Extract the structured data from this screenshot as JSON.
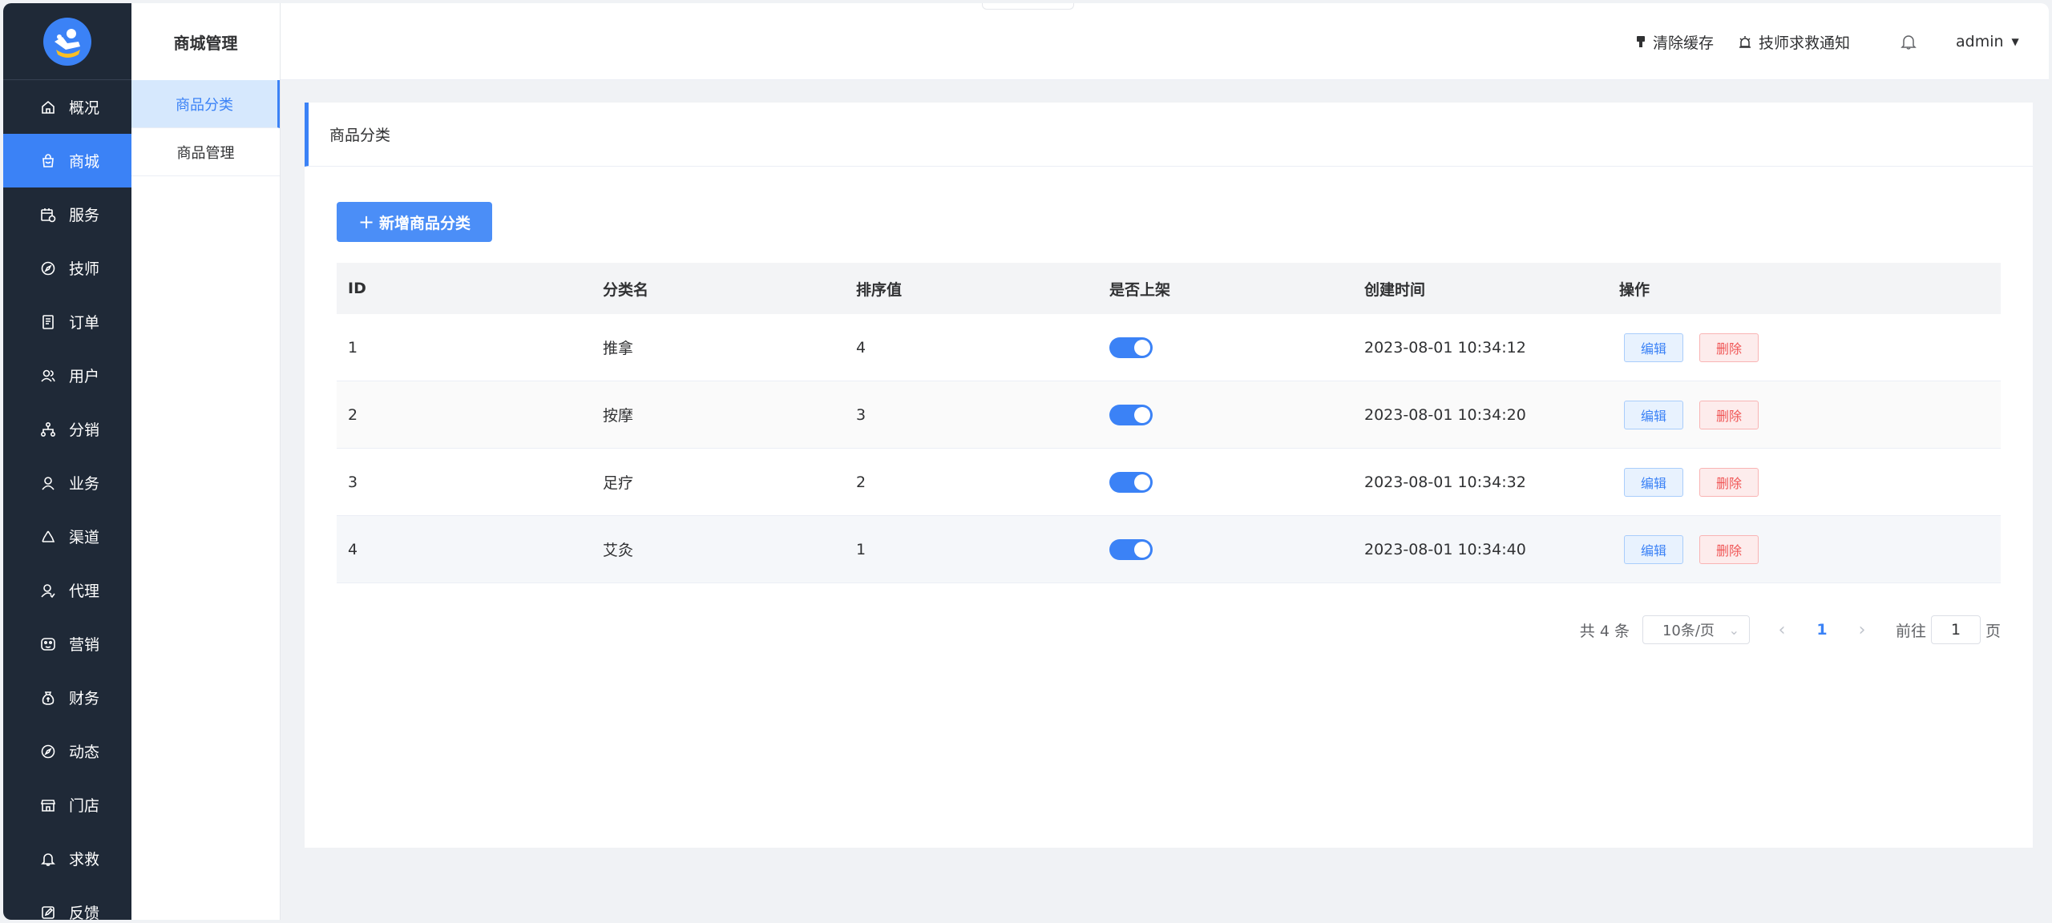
{
  "nav": {
    "items": [
      {
        "label": "概况",
        "icon": "home-icon"
      },
      {
        "label": "商城",
        "icon": "shopping-bag-icon",
        "active": true
      },
      {
        "label": "服务",
        "icon": "calendar-clock-icon"
      },
      {
        "label": "技师",
        "icon": "compass-icon"
      },
      {
        "label": "订单",
        "icon": "document-icon"
      },
      {
        "label": "用户",
        "icon": "users-icon"
      },
      {
        "label": "分销",
        "icon": "hierarchy-icon"
      },
      {
        "label": "业务",
        "icon": "user-icon"
      },
      {
        "label": "渠道",
        "icon": "recycle-icon"
      },
      {
        "label": "代理",
        "icon": "user-check-icon"
      },
      {
        "label": "营销",
        "icon": "palette-icon"
      },
      {
        "label": "财务",
        "icon": "money-bag-icon"
      },
      {
        "label": "动态",
        "icon": "compass-icon"
      },
      {
        "label": "门店",
        "icon": "store-icon"
      },
      {
        "label": "求救",
        "icon": "bell-icon"
      },
      {
        "label": "反馈",
        "icon": "edit-icon"
      }
    ]
  },
  "subnav": {
    "title": "商城管理",
    "items": [
      {
        "label": "商品分类",
        "active": true
      },
      {
        "label": "商品管理",
        "active": false
      }
    ]
  },
  "header": {
    "clear_cache": "清除缓存",
    "sos_notice": "技师求救通知",
    "user": "admin"
  },
  "panel": {
    "title": "商品分类",
    "add_button": "新增商品分类"
  },
  "table": {
    "headers": [
      "ID",
      "分类名",
      "排序值",
      "是否上架",
      "创建时间",
      "操作"
    ],
    "rows": [
      {
        "id": "1",
        "name": "推拿",
        "sort": "4",
        "on_shelf": true,
        "created": "2023-08-01 10:34:12"
      },
      {
        "id": "2",
        "name": "按摩",
        "sort": "3",
        "on_shelf": true,
        "created": "2023-08-01 10:34:20"
      },
      {
        "id": "3",
        "name": "足疗",
        "sort": "2",
        "on_shelf": true,
        "created": "2023-08-01 10:34:32"
      },
      {
        "id": "4",
        "name": "艾灸",
        "sort": "1",
        "on_shelf": true,
        "created": "2023-08-01 10:34:40"
      }
    ],
    "edit_label": "编辑",
    "delete_label": "删除"
  },
  "pagination": {
    "total": "共 4 条",
    "page_size": "10条/页",
    "current_page": "1",
    "goto_prefix": "前往",
    "goto_value": "1",
    "goto_suffix": "页"
  },
  "colors": {
    "accent": "#3b82f6",
    "nav_bg": "#1f2937",
    "danger": "#f05656"
  }
}
